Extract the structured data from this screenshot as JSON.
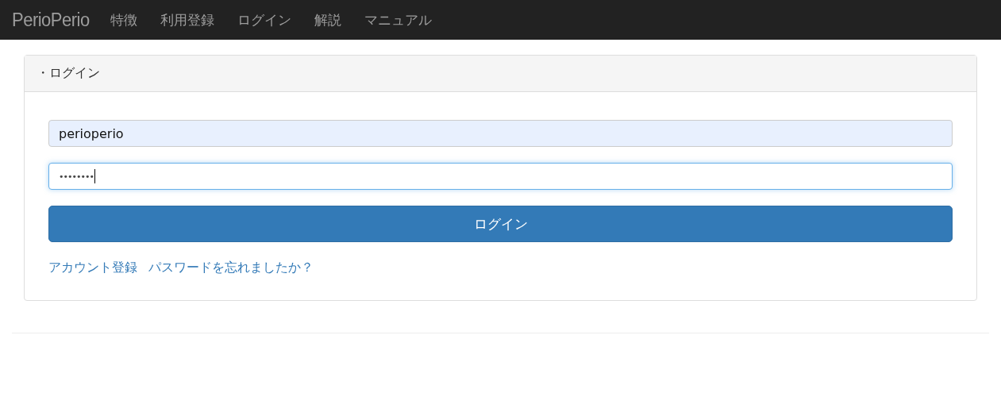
{
  "navbar": {
    "brand": "PerioPerio",
    "items": [
      "特徴",
      "利用登録",
      "ログイン",
      "解説",
      "マニュアル"
    ]
  },
  "panel": {
    "title": "・ログイン",
    "fields": [
      {
        "kind": "text",
        "value": "perioperio",
        "autofilled": true,
        "focused": false
      },
      {
        "kind": "password",
        "value": "••••••••",
        "autofilled": false,
        "focused": true
      }
    ],
    "submit": "ログイン",
    "links": [
      "アカウント登録",
      "パスワードを忘れましたか？"
    ]
  }
}
